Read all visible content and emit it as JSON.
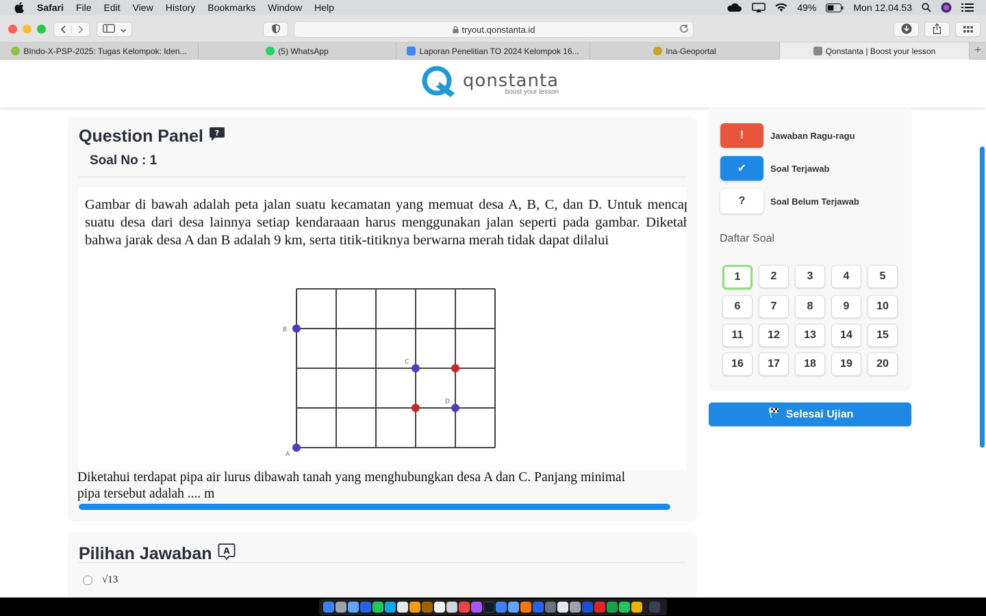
{
  "menubar": {
    "app": "Safari",
    "items": [
      "File",
      "Edit",
      "View",
      "History",
      "Bookmarks",
      "Window",
      "Help"
    ],
    "battery": "49%",
    "clock": "Mon 12.04.53"
  },
  "browser": {
    "url": "tryout.qonstanta.id",
    "tabs": [
      {
        "label": "BIndo-X-PSP-2025: Tugas Kelompok: Iden...",
        "color": "#8bc34a"
      },
      {
        "label": "(5) WhatsApp",
        "color": "#25d366"
      },
      {
        "label": "Laporan Penelitian TO 2024 Kelompok 16...",
        "color": "#4285f4"
      },
      {
        "label": "Ina-Geoportal",
        "color": "#c9a227"
      },
      {
        "label": "Qonstanta | Boost your lesson",
        "color": "#888888"
      }
    ]
  },
  "site": {
    "logo_name": "qonstanta",
    "logo_tagline": "boost your lesson"
  },
  "question_panel": {
    "title": "Question Panel",
    "soal_no": "Soal No : 1",
    "text": "Gambar di bawah adalah peta jalan suatu kecamatan yang memuat desa A, B, C, dan D. Untuk mencapai suatu desa dari desa lainnya setiap kendaraaan harus menggunakan jalan seperti pada gambar. Diketahui bahwa jarak desa A dan B adalah 9 km, serta titik-titiknya berwarna merah tidak dapat dilalui",
    "question": "Diketahui terdapat pipa air lurus dibawah tanah yang menghubungkan desa A dan C. Panjang minimal pipa tersebut adalah .... m",
    "figure_labels": {
      "a": "A",
      "b": "B",
      "c": "C",
      "d": "D"
    },
    "scroll_progress": 1.0
  },
  "answer_panel": {
    "title": "Pilihan Jawaban",
    "options": [
      {
        "label": "√13"
      }
    ]
  },
  "sidebar": {
    "legend": [
      {
        "symbol": "!",
        "label": "Jawaban Ragu-ragu",
        "bg": "#e8553a",
        "fg": "#ffffff"
      },
      {
        "symbol": "✔",
        "label": "Soal Terjawab",
        "bg": "#1e88e5",
        "fg": "#ffffff"
      },
      {
        "symbol": "?",
        "label": "Soal Belum Terjawab",
        "bg": "#ffffff",
        "fg": "#333333"
      }
    ],
    "daftar_title": "Daftar Soal",
    "numbers": [
      "1",
      "2",
      "3",
      "4",
      "5",
      "6",
      "7",
      "8",
      "9",
      "10",
      "11",
      "12",
      "13",
      "14",
      "15",
      "16",
      "17",
      "18",
      "19",
      "20"
    ],
    "current": "1",
    "finish_label": "Selesai Ujian"
  }
}
